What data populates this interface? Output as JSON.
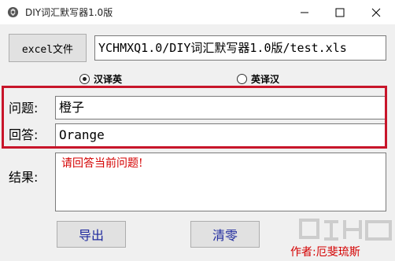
{
  "window": {
    "title": "DIY词汇默写器1.0版"
  },
  "toolbar": {
    "excel_button_label": "excel文件",
    "file_path": "YCHMXQ1.0/DIY词汇默写器1.0版/test.xls"
  },
  "mode": {
    "options": [
      {
        "label": "汉译英",
        "selected": true
      },
      {
        "label": "英译汉",
        "selected": false
      }
    ]
  },
  "form": {
    "question_label": "问题:",
    "question_value": "橙子",
    "answer_label": "回答:",
    "answer_value": "Orange",
    "result_label": "结果:",
    "result_message": "请回答当前问题!"
  },
  "actions": {
    "export_label": "导出",
    "clear_label": "清零"
  },
  "footer": {
    "author": "作者:厄斐琉斯"
  },
  "colors": {
    "highlight_border": "#c8152a",
    "result_text": "#d40000",
    "button_text": "#1f2a9e"
  }
}
